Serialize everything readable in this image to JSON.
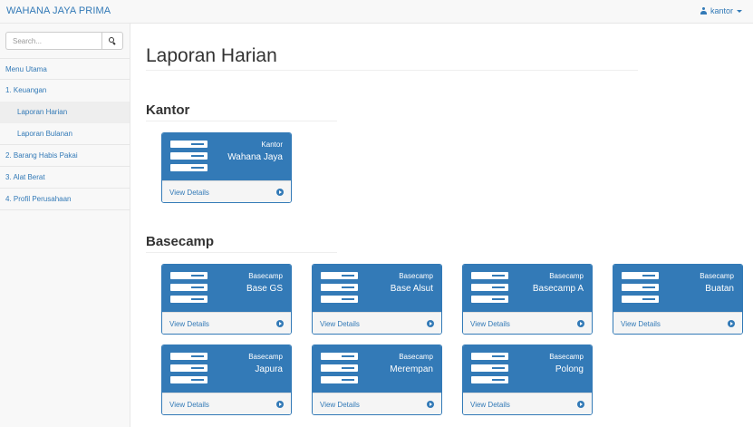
{
  "navbar": {
    "brand": "WAHANA JAYA PRIMA",
    "user_label": "kantor"
  },
  "search": {
    "placeholder": "Search..."
  },
  "sidebar": {
    "items": [
      {
        "label": "Menu Utama"
      },
      {
        "label": "1. Keuangan"
      },
      {
        "label": "Laporan Harian"
      },
      {
        "label": "Laporan Bulanan"
      },
      {
        "label": "2. Barang Habis Pakai"
      },
      {
        "label": "3. Alat Berat"
      },
      {
        "label": "4. Profil Perusahaan"
      }
    ]
  },
  "main": {
    "page_title": "Laporan Harian",
    "sections": [
      {
        "title": "Kantor",
        "cards": [
          {
            "label": "Kantor",
            "name": "Wahana Jaya",
            "link": "View Details"
          }
        ]
      },
      {
        "title": "Basecamp",
        "cards": [
          {
            "label": "Basecamp",
            "name": "Base GS",
            "link": "View Details"
          },
          {
            "label": "Basecamp",
            "name": "Base Alsut",
            "link": "View Details"
          },
          {
            "label": "Basecamp",
            "name": "Basecamp A",
            "link": "View Details"
          },
          {
            "label": "Basecamp",
            "name": "Buatan",
            "link": "View Details"
          },
          {
            "label": "Basecamp",
            "name": "Japura",
            "link": "View Details"
          },
          {
            "label": "Basecamp",
            "name": "Merempan",
            "link": "View Details"
          },
          {
            "label": "Basecamp",
            "name": "Polong",
            "link": "View Details"
          }
        ]
      }
    ]
  },
  "colors": {
    "primary": "#337ab7",
    "navbar_bg": "#f8f8f8",
    "card_footer_bg": "#f5f5f5"
  },
  "icons": {
    "card_icon": "server-stack-icon",
    "card_arrow": "arrow-circle-right-icon",
    "user": "user-icon",
    "search": "search-icon"
  }
}
